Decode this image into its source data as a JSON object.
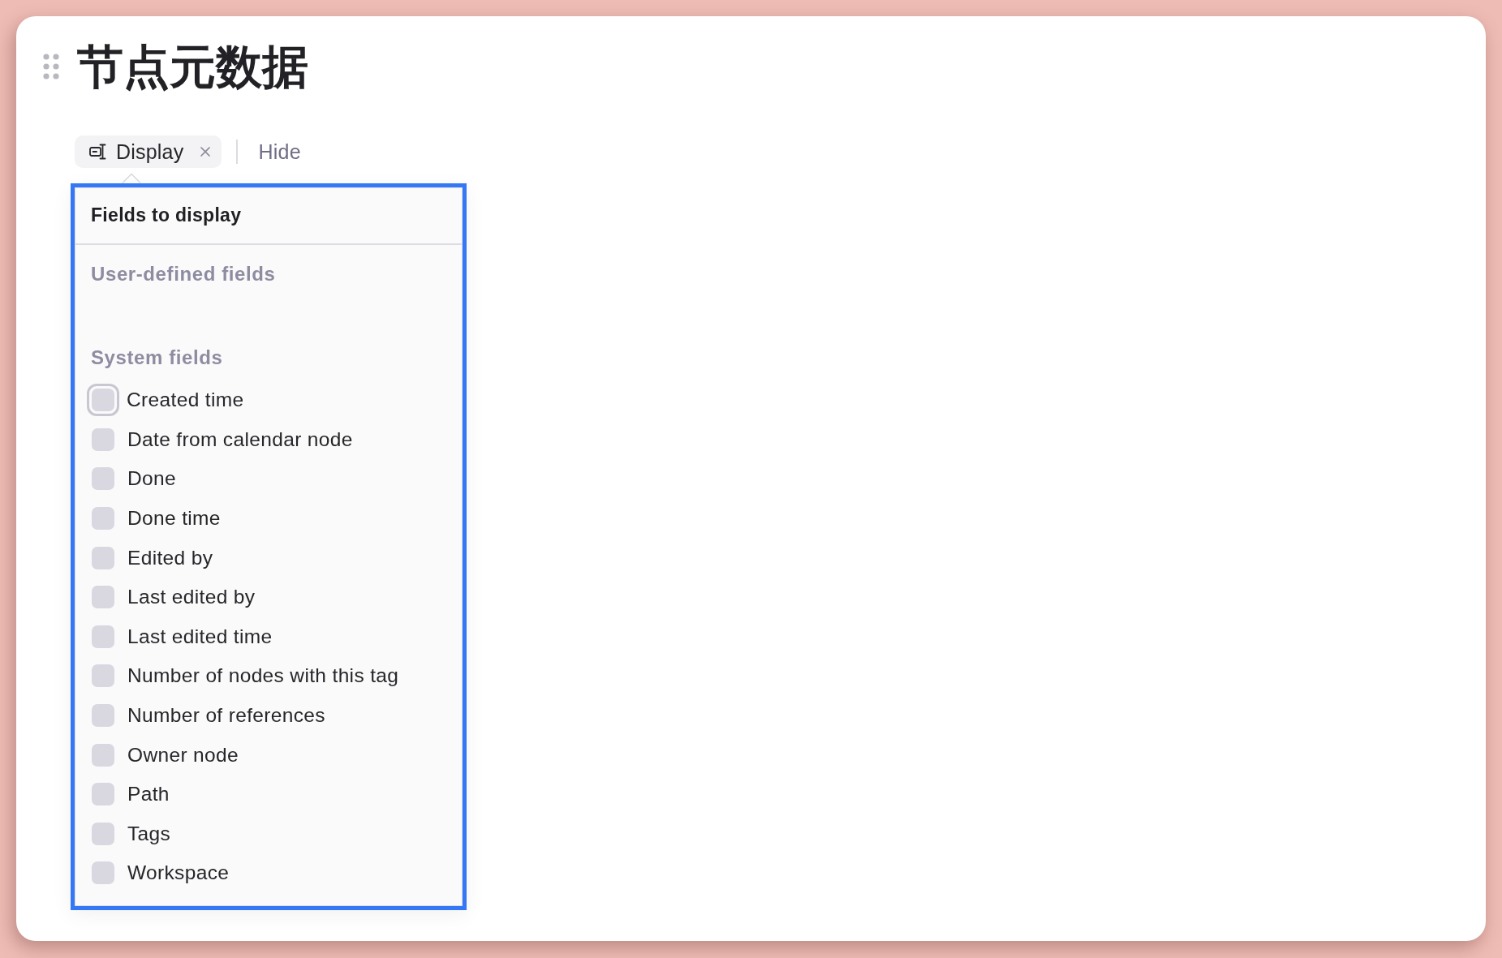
{
  "page": {
    "title": "节点元数据"
  },
  "toolbar": {
    "display_chip": {
      "label": "Display",
      "open": true
    },
    "hide_button": {
      "label": "Hide"
    }
  },
  "popover": {
    "highlighted": true,
    "title": "Fields to display",
    "sections": [
      {
        "heading": "User-defined fields"
      },
      {
        "heading": "System fields",
        "fields": [
          {
            "label": "Created time",
            "checked": false,
            "focused": true
          },
          {
            "label": "Date from calendar node",
            "checked": false,
            "focused": false
          },
          {
            "label": "Done",
            "checked": false,
            "focused": false
          },
          {
            "label": "Done time",
            "checked": false,
            "focused": false
          },
          {
            "label": "Edited by",
            "checked": false,
            "focused": false
          },
          {
            "label": "Last edited by",
            "checked": false,
            "focused": false
          },
          {
            "label": "Last edited time",
            "checked": false,
            "focused": false
          },
          {
            "label": "Number of nodes with this tag",
            "checked": false,
            "focused": false
          },
          {
            "label": "Number of references",
            "checked": false,
            "focused": false
          },
          {
            "label": "Owner node",
            "checked": false,
            "focused": false
          },
          {
            "label": "Path",
            "checked": false,
            "focused": false
          },
          {
            "label": "Tags",
            "checked": false,
            "focused": false
          },
          {
            "label": "Workspace",
            "checked": false,
            "focused": false
          }
        ]
      }
    ]
  }
}
